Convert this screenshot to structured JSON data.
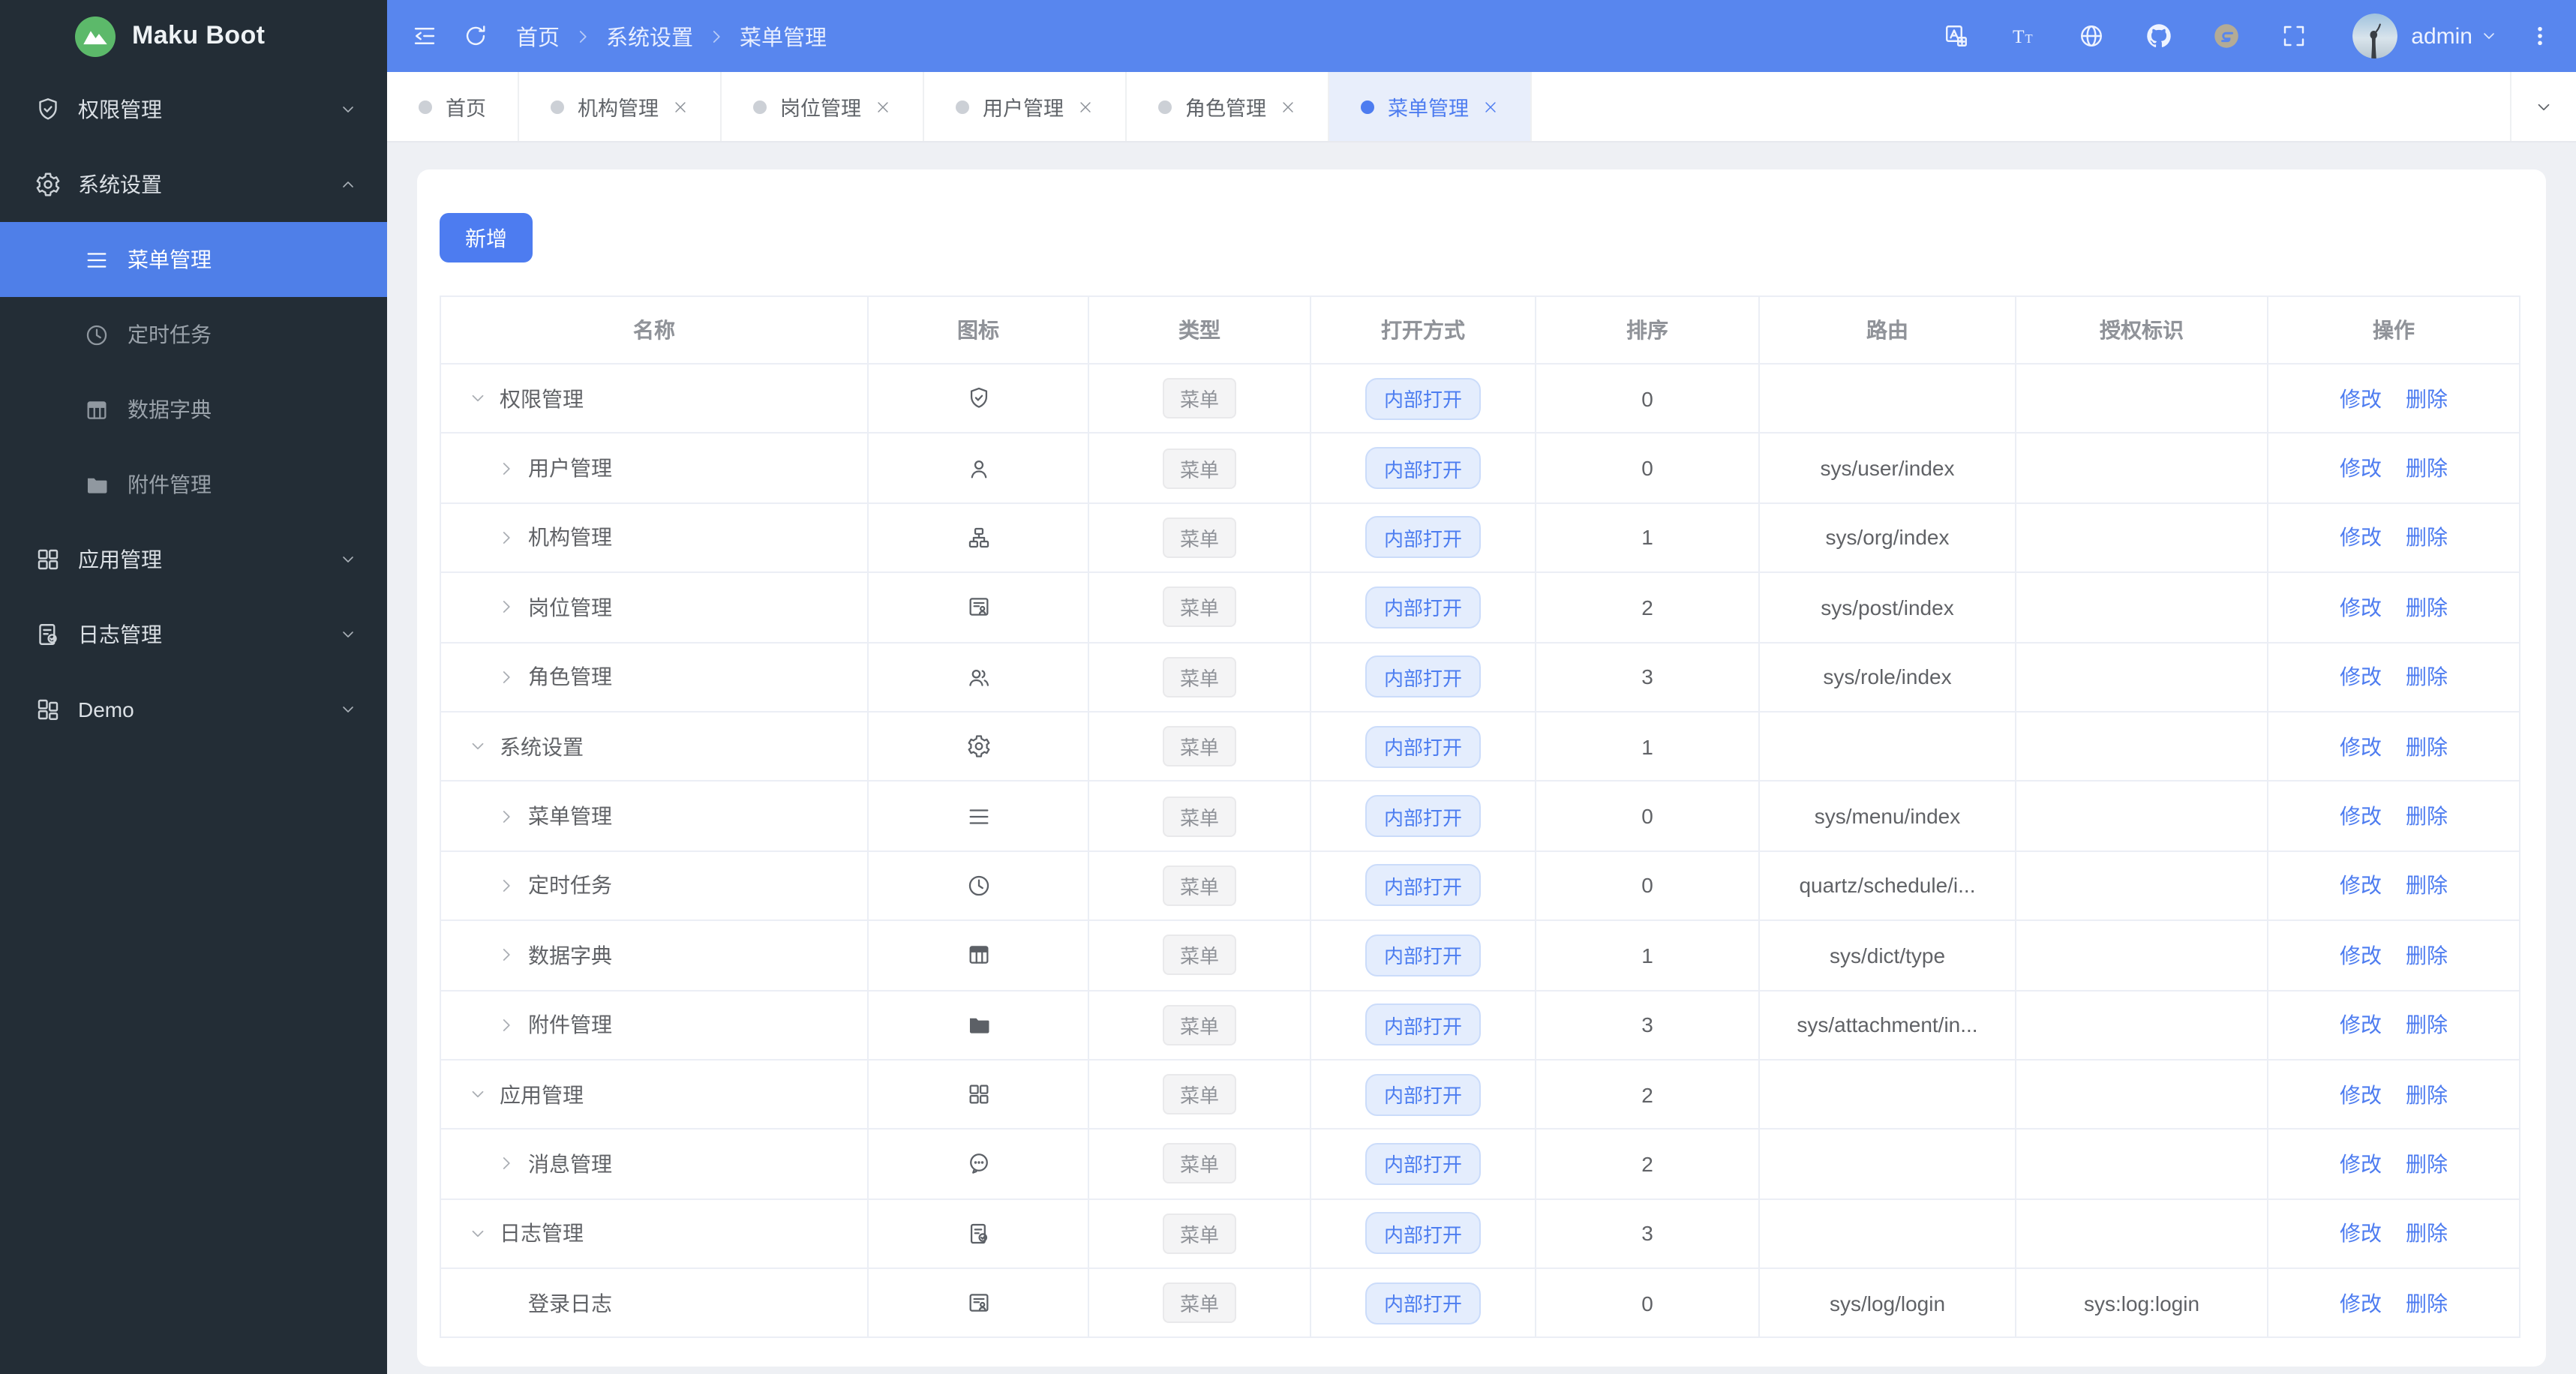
{
  "colors": {
    "accent": "#4d7cf0",
    "header_bg": "#5886ee",
    "sidebar_bg": "#232d36",
    "sidebar_active_bg": "#4f7fe8",
    "logo_green": "#5cb96a",
    "page_bg": "#eef0f4",
    "tag_gray_bg": "#f4f4f5",
    "tag_gray_text": "#909399",
    "tag_blue_bg": "#e4edfd",
    "tag_blue_text": "#4c7df0",
    "link_blue": "#4d7cf0",
    "gitee_tan": "#b3ab96"
  },
  "brand": {
    "title": "Maku Boot",
    "logo_icon": "mountain-icon"
  },
  "header": {
    "left_buttons": [
      {
        "key": "collapse",
        "icon": "collapse-icon"
      },
      {
        "key": "refresh",
        "icon": "refresh-icon"
      }
    ],
    "breadcrumb": [
      "首页",
      "系统设置",
      "菜单管理"
    ],
    "tools": [
      {
        "key": "translate",
        "icon": "translate-icon"
      },
      {
        "key": "font-size",
        "icon": "font-size-icon"
      },
      {
        "key": "language",
        "icon": "globe-icon"
      },
      {
        "key": "github",
        "icon": "github-icon"
      },
      {
        "key": "gitee",
        "icon": "gitee-icon",
        "tan": true
      },
      {
        "key": "fullscreen",
        "icon": "fullscreen-icon"
      }
    ],
    "user": {
      "name": "admin",
      "avatar_icon": "avatar-photo",
      "caret_icon": "chevron-down-icon"
    },
    "more_icon": "more-vertical-icon"
  },
  "tabs": [
    {
      "key": "home",
      "label": "首页",
      "closable": false,
      "active": false
    },
    {
      "key": "org",
      "label": "机构管理",
      "closable": true,
      "active": false
    },
    {
      "key": "post",
      "label": "岗位管理",
      "closable": true,
      "active": false
    },
    {
      "key": "user",
      "label": "用户管理",
      "closable": true,
      "active": false
    },
    {
      "key": "role",
      "label": "角色管理",
      "closable": true,
      "active": false
    },
    {
      "key": "menu",
      "label": "菜单管理",
      "closable": true,
      "active": true
    }
  ],
  "tabs_dropdown_icon": "chevron-down-icon",
  "sidebar": {
    "items": [
      {
        "key": "permission",
        "label": "权限管理",
        "icon": "shield-check-icon",
        "chevron": "chevron-down-icon"
      },
      {
        "key": "system",
        "label": "系统设置",
        "icon": "gear-icon",
        "chevron": "chevron-up-icon",
        "open": true,
        "children": [
          {
            "key": "menu",
            "label": "菜单管理",
            "icon": "menu-icon",
            "active": true
          },
          {
            "key": "schedule",
            "label": "定时任务",
            "icon": "clock-icon",
            "active": false
          },
          {
            "key": "dict",
            "label": "数据字典",
            "icon": "dict-table-icon",
            "active": false
          },
          {
            "key": "attachment",
            "label": "附件管理",
            "icon": "folder-icon",
            "active": false
          }
        ]
      },
      {
        "key": "app",
        "label": "应用管理",
        "icon": "app-grid-icon",
        "chevron": "chevron-down-icon"
      },
      {
        "key": "log",
        "label": "日志管理",
        "icon": "log-doc-icon",
        "chevron": "chevron-down-icon"
      },
      {
        "key": "demo",
        "label": "Demo",
        "icon": "demo-grid-icon",
        "chevron": "chevron-down-icon"
      }
    ]
  },
  "toolbar": {
    "add_label": "新增"
  },
  "table": {
    "columns": [
      "名称",
      "图标",
      "类型",
      "打开方式",
      "排序",
      "路由",
      "授权标识",
      "操作"
    ],
    "actions": [
      "修改",
      "删除"
    ],
    "rows": [
      {
        "name": "权限管理",
        "level": 0,
        "expand": "down",
        "icon": "shield-check-icon",
        "type": "菜单",
        "open": "内部打开",
        "sort": "0",
        "route": "",
        "auth": ""
      },
      {
        "name": "用户管理",
        "level": 1,
        "expand": "right",
        "icon": "user-icon",
        "type": "菜单",
        "open": "内部打开",
        "sort": "0",
        "route": "sys/user/index",
        "auth": ""
      },
      {
        "name": "机构管理",
        "level": 1,
        "expand": "right",
        "icon": "org-icon",
        "type": "菜单",
        "open": "内部打开",
        "sort": "1",
        "route": "sys/org/index",
        "auth": ""
      },
      {
        "name": "岗位管理",
        "level": 1,
        "expand": "right",
        "icon": "id-card-icon",
        "type": "菜单",
        "open": "内部打开",
        "sort": "2",
        "route": "sys/post/index",
        "auth": ""
      },
      {
        "name": "角色管理",
        "level": 1,
        "expand": "right",
        "icon": "users-icon",
        "type": "菜单",
        "open": "内部打开",
        "sort": "3",
        "route": "sys/role/index",
        "auth": ""
      },
      {
        "name": "系统设置",
        "level": 0,
        "expand": "down",
        "icon": "gear-icon",
        "type": "菜单",
        "open": "内部打开",
        "sort": "1",
        "route": "",
        "auth": ""
      },
      {
        "name": "菜单管理",
        "level": 1,
        "expand": "right",
        "icon": "menu-icon",
        "type": "菜单",
        "open": "内部打开",
        "sort": "0",
        "route": "sys/menu/index",
        "auth": ""
      },
      {
        "name": "定时任务",
        "level": 1,
        "expand": "right",
        "icon": "clock-icon",
        "type": "菜单",
        "open": "内部打开",
        "sort": "0",
        "route": "quartz/schedule/i...",
        "auth": ""
      },
      {
        "name": "数据字典",
        "level": 1,
        "expand": "right",
        "icon": "dict-table-icon",
        "type": "菜单",
        "open": "内部打开",
        "sort": "1",
        "route": "sys/dict/type",
        "auth": ""
      },
      {
        "name": "附件管理",
        "level": 1,
        "expand": "right",
        "icon": "folder-icon",
        "type": "菜单",
        "open": "内部打开",
        "sort": "3",
        "route": "sys/attachment/in...",
        "auth": ""
      },
      {
        "name": "应用管理",
        "level": 0,
        "expand": "down",
        "icon": "app-grid-icon",
        "type": "菜单",
        "open": "内部打开",
        "sort": "2",
        "route": "",
        "auth": ""
      },
      {
        "name": "消息管理",
        "level": 1,
        "expand": "right",
        "icon": "chat-icon",
        "type": "菜单",
        "open": "内部打开",
        "sort": "2",
        "route": "",
        "auth": ""
      },
      {
        "name": "日志管理",
        "level": 0,
        "expand": "down",
        "icon": "log-doc-icon",
        "type": "菜单",
        "open": "内部打开",
        "sort": "3",
        "route": "",
        "auth": ""
      },
      {
        "name": "登录日志",
        "level": 1,
        "expand": "none",
        "icon": "id-card-icon",
        "type": "菜单",
        "open": "内部打开",
        "sort": "0",
        "route": "sys/log/login",
        "auth": "sys:log:login"
      }
    ]
  }
}
